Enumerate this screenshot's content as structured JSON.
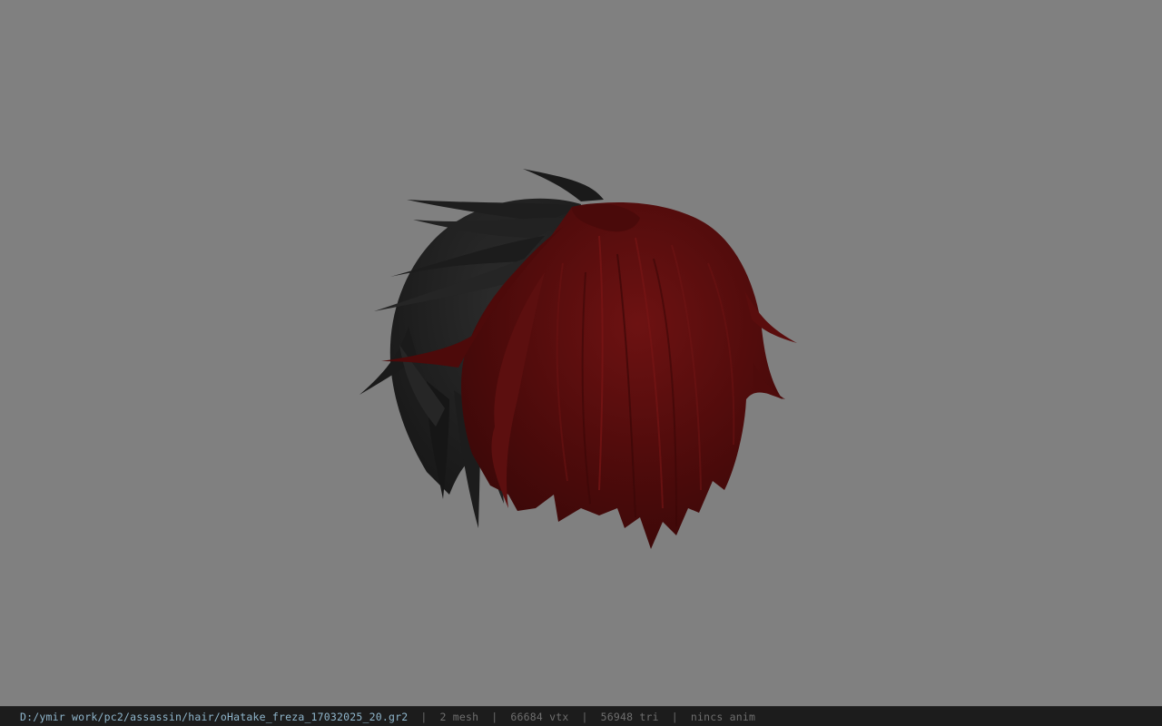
{
  "viewport": {
    "background": "#808080",
    "model_name": "oHatake_freza_17032025_20.gr2",
    "model_colors": {
      "dark_strands": "#1f1f1f",
      "red_strands": "#5a0d0d",
      "red_highlight": "#7a1616"
    }
  },
  "statusbar": {
    "file_path": "D:/ymir work/pc2/assassin/hair/oHatake_freza_17032025_20.gr2",
    "separator": "|",
    "mesh_count": "2 mesh",
    "vertex_count": "66684 vtx",
    "triangle_count": "56948 tri",
    "animation": "nincs anim"
  }
}
